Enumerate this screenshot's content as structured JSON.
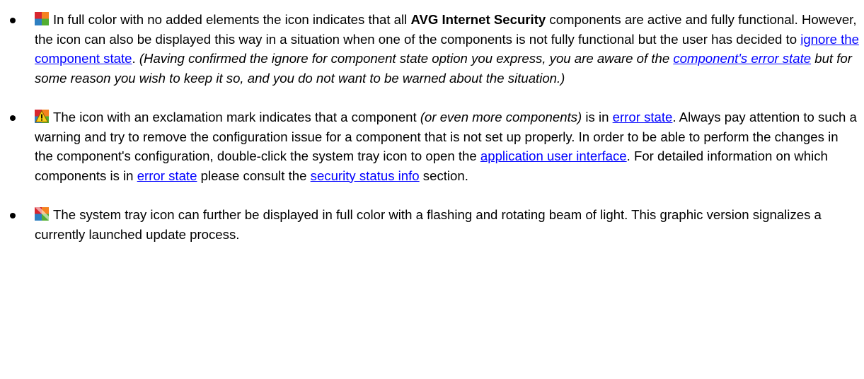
{
  "colors": {
    "link": "#0000ff",
    "text": "#000000",
    "icon_red": "#d8262e",
    "icon_orange": "#f58220",
    "icon_green": "#52ae32",
    "icon_blue": "#2e7fc1",
    "warning_yellow": "#f7d117"
  },
  "items": [
    {
      "icon": "avg-tray-icon-full-color",
      "t1": "In full color with no added elements the icon indicates that all ",
      "product": "AVG Internet Security",
      "t2": " components are active and fully functional. However, the icon can also be displayed this way in a situation when one of the components is not fully functional but the user has decided to ",
      "link1": "ignore the component state",
      "t3": ". ",
      "i1": "(Having confirmed the ignore for component state option you express, you are aware of the ",
      "link2": "component's error state",
      "i2": " but for some reason you wish to keep it so, and you do not want to be warned about the situation.)"
    },
    {
      "icon": "avg-tray-icon-warning",
      "t1": "The icon with an exclamation mark indicates that a component ",
      "i1": "(or even more components)",
      "t2": " is in ",
      "link1": "error state",
      "t3": ". Always pay attention to such a warning and try to remove the configuration issue for a component that is not set up properly. In order to be able to perform the changes in the component's configuration, double-click the system tray icon to open the ",
      "link2": "application user interface",
      "t4": ". For detailed information on which components is in ",
      "link3": "error state",
      "t5": " please consult the ",
      "link4": "security status info",
      "t6": " section."
    },
    {
      "icon": "avg-tray-icon-updating",
      "t1": "The system tray icon can further be displayed in full color with a flashing and rotating beam of light. This graphic version signalizes a currently launched update process."
    }
  ]
}
